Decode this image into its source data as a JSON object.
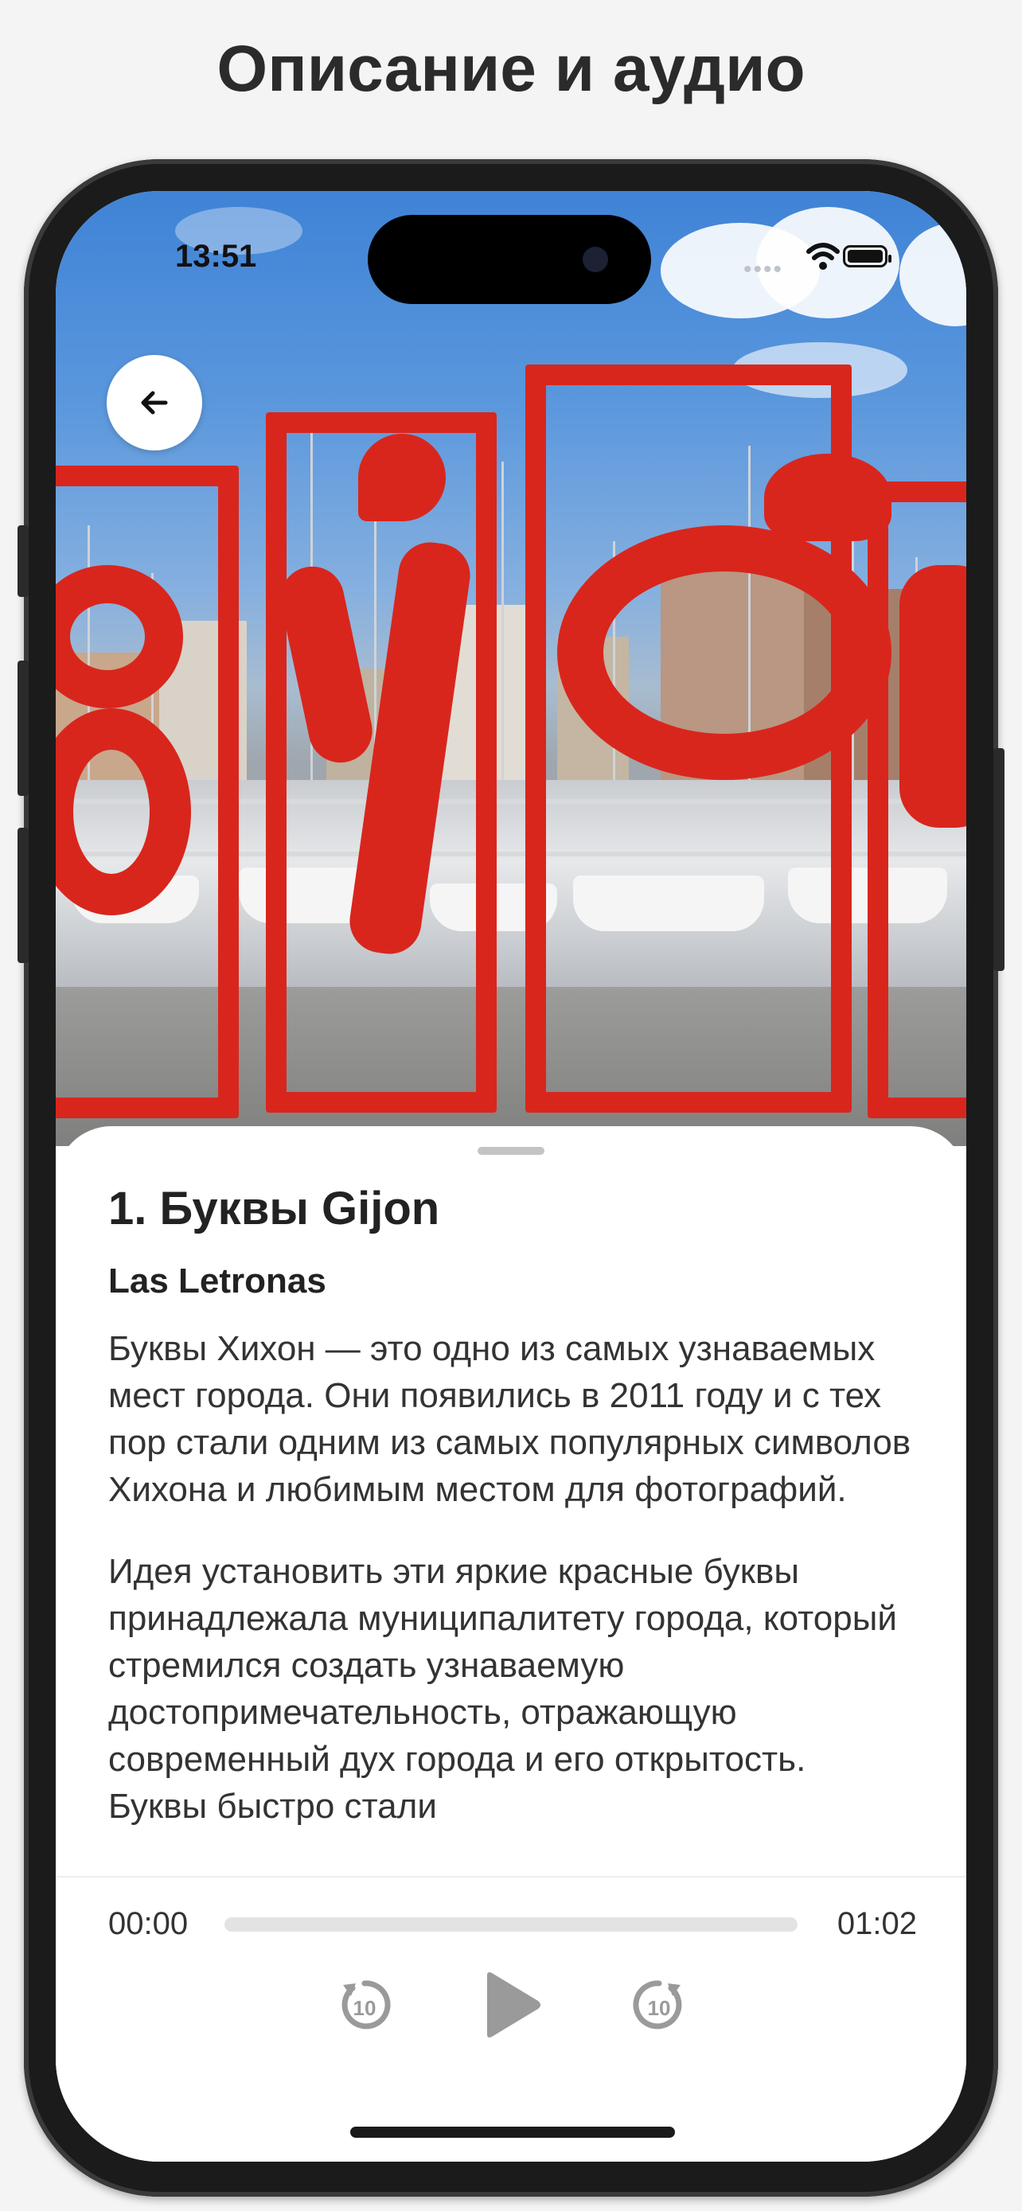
{
  "banner": {
    "title": "Описание и аудио"
  },
  "status_bar": {
    "time": "13:51",
    "icons": [
      "signal-dots-icon",
      "wifi-icon",
      "battery-icon"
    ]
  },
  "navigation": {
    "back_icon": "arrow-left-icon"
  },
  "place": {
    "title": "1. Буквы Gijon",
    "subtitle": "Las Letronas",
    "paragraphs": [
      "Буквы Хихон — это одно из самых узнаваемых мест города. Они появились в 2011 году и с тех пор стали одним из самых популярных символов Хихона и любимым местом для фотографий.",
      "Идея установить эти яркие красные буквы принадлежала муниципалитету города, который стремился создать узнаваемую достопримечательность, отражающую современный дух города и его открытость. Буквы быстро стали"
    ]
  },
  "player": {
    "current_time": "00:00",
    "total_time": "01:02",
    "progress": 0.0,
    "rewind_icon": "rewind-10-icon",
    "play_icon": "play-icon",
    "forward_icon": "forward-10-icon"
  },
  "colors": {
    "accent_red": "#d8261d",
    "control_grey": "#9a9a9a",
    "text": "#222222"
  }
}
